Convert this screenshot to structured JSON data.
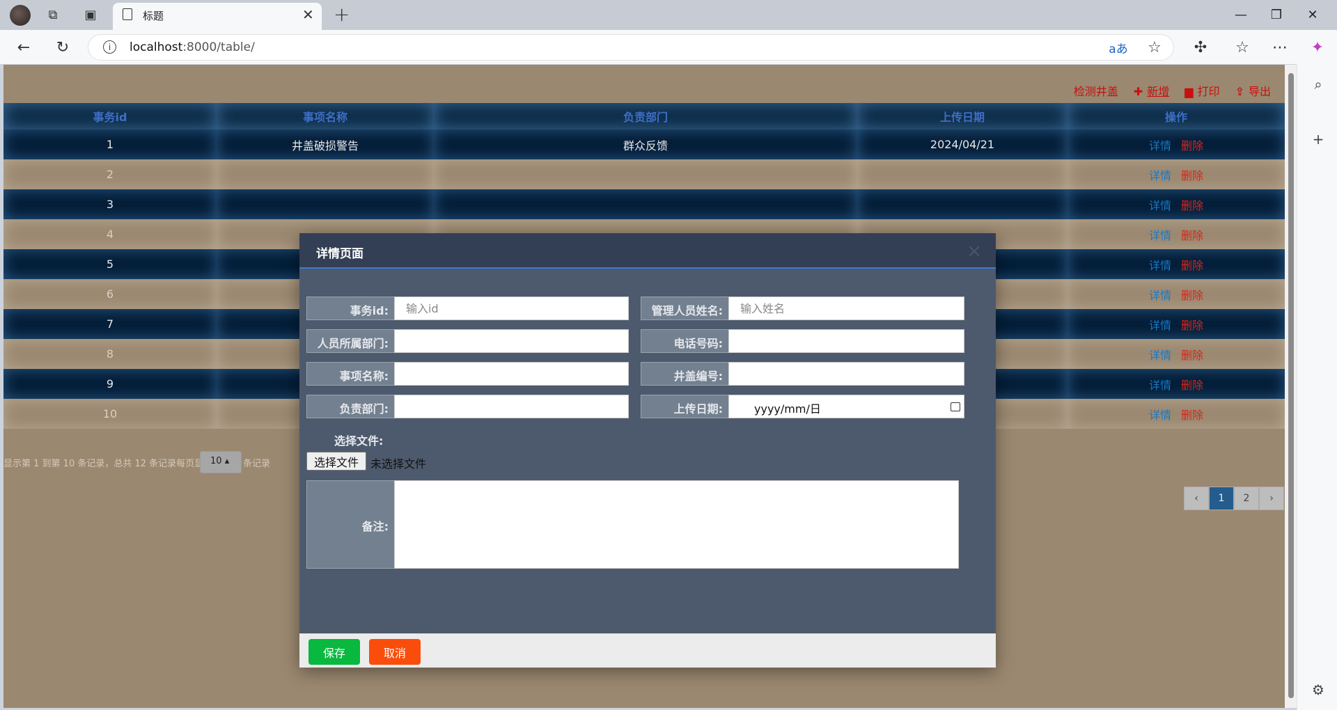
{
  "browser": {
    "tab_title": "标题",
    "url_host": "localhost",
    "url_path": ":8000/table/"
  },
  "top_actions": {
    "detect": "检测井盖",
    "add": "新增",
    "print": "打印",
    "export": "导出"
  },
  "table": {
    "headers": [
      "事务id",
      "事项名称",
      "负责部门",
      "上传日期",
      "操作"
    ],
    "rows": [
      {
        "id": "1",
        "name": "井盖破损警告",
        "dept": "群众反馈",
        "date": "2024/04/21"
      },
      {
        "id": "2",
        "name": "",
        "dept": "",
        "date": ""
      },
      {
        "id": "3",
        "name": "",
        "dept": "",
        "date": ""
      },
      {
        "id": "4",
        "name": "",
        "dept": "",
        "date": ""
      },
      {
        "id": "5",
        "name": "",
        "dept": "",
        "date": ""
      },
      {
        "id": "6",
        "name": "",
        "dept": "",
        "date": ""
      },
      {
        "id": "7",
        "name": "",
        "dept": "",
        "date": ""
      },
      {
        "id": "8",
        "name": "",
        "dept": "",
        "date": ""
      },
      {
        "id": "9",
        "name": "",
        "dept": "",
        "date": ""
      },
      {
        "id": "10",
        "name": "",
        "dept": "",
        "date": ""
      }
    ],
    "op_detail": "详情",
    "op_delete": "删除"
  },
  "pagination": {
    "info_before": "显示第 1 到第 10 条记录，总共 12 条记录每页显示",
    "page_size": "10",
    "info_after": "条记录",
    "prev": "‹",
    "pages": [
      "1",
      "2"
    ],
    "next": "›"
  },
  "modal": {
    "title": "详情页面",
    "close": "×",
    "fields": {
      "id_label": "事务id:",
      "id_placeholder": "输入id",
      "manager_label": "管理人员姓名:",
      "manager_placeholder": "输入姓名",
      "staff_dept_label": "人员所属部门:",
      "phone_label": "电话号码:",
      "name_label": "事项名称:",
      "cover_no_label": "井盖编号:",
      "dept_label": "负责部门:",
      "date_label": "上传日期:",
      "date_placeholder": "yyyy/mm/日",
      "file_label": "选择文件:",
      "file_button": "选择文件",
      "file_none": "未选择文件",
      "note_label": "备注:"
    },
    "save": "保存",
    "cancel": "取消"
  }
}
